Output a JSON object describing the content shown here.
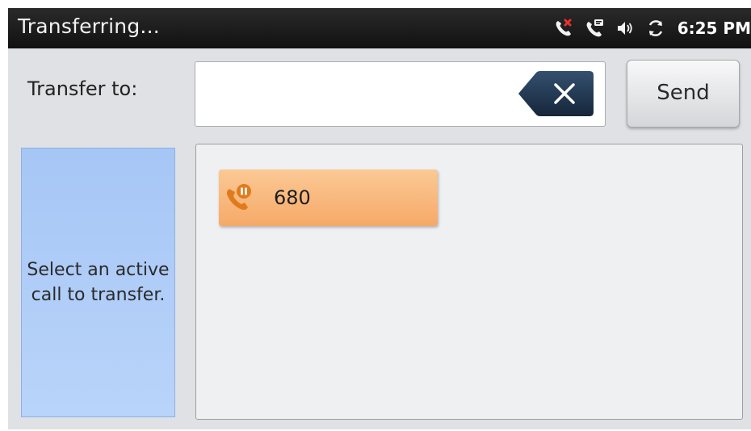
{
  "status_bar": {
    "title": "Transferring...",
    "time": "6:25 PM",
    "icons": [
      "missed-call-icon",
      "voicemail-call-icon",
      "speaker-volume-icon",
      "sync-icon"
    ]
  },
  "transfer": {
    "label": "Transfer to:",
    "value": "",
    "placeholder": "",
    "send_label": "Send"
  },
  "hint": {
    "text": "Select an active call to transfer."
  },
  "calls": [
    {
      "number": "680",
      "icon": "held-call-icon"
    }
  ],
  "colors": {
    "status_bar": "#1c1c1c",
    "background": "#dfe1e4",
    "hint_panel": "#b0cdf8",
    "call_item": "#f8b77c",
    "call_icon": "#e07b1c",
    "missed_call_badge": "#e83030",
    "backspace_key": "#1f3450"
  }
}
